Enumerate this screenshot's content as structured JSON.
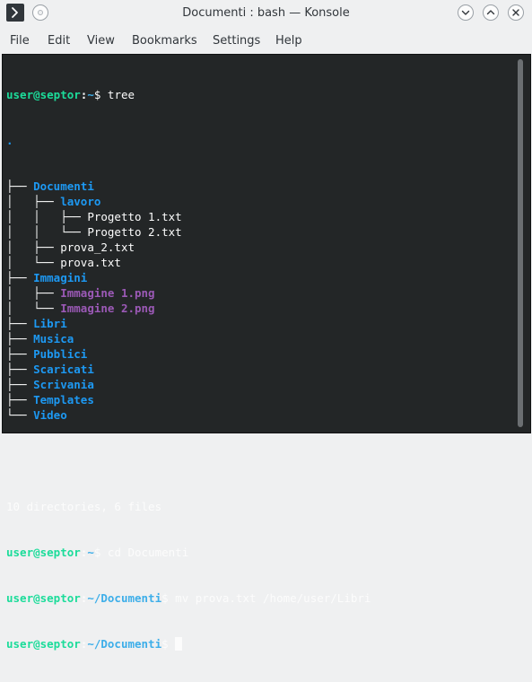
{
  "window": {
    "title": "Documenti : bash — Konsole",
    "app_icon": "konsole-icon",
    "controls": [
      "pin-icon",
      "minimize-icon",
      "maximize-icon",
      "close-icon"
    ]
  },
  "menubar": {
    "items": [
      "File",
      "Edit",
      "View",
      "Bookmarks",
      "Settings",
      "Help"
    ]
  },
  "terminal": {
    "prompt_user_host": "user@septor",
    "prompt_colon": ":",
    "prompt_dollar": "$",
    "cmd1_path": "~",
    "cmd1": " tree",
    "tree_root": ".",
    "tree": [
      {
        "prefix": "├── ",
        "name": "Documenti",
        "kind": "dir"
      },
      {
        "prefix": "│   ├── ",
        "name": "lavoro",
        "kind": "dir"
      },
      {
        "prefix": "│   │   ├── ",
        "name": "Progetto 1.txt",
        "kind": "file"
      },
      {
        "prefix": "│   │   └── ",
        "name": "Progetto 2.txt",
        "kind": "file"
      },
      {
        "prefix": "│   ├── ",
        "name": "prova_2.txt",
        "kind": "file"
      },
      {
        "prefix": "│   └── ",
        "name": "prova.txt",
        "kind": "file"
      },
      {
        "prefix": "├── ",
        "name": "Immagini",
        "kind": "dir"
      },
      {
        "prefix": "│   ├── ",
        "name": "Immagine 1.png",
        "kind": "image"
      },
      {
        "prefix": "│   └── ",
        "name": "Immagine 2.png",
        "kind": "image"
      },
      {
        "prefix": "├── ",
        "name": "Libri",
        "kind": "dir"
      },
      {
        "prefix": "├── ",
        "name": "Musica",
        "kind": "dir"
      },
      {
        "prefix": "├── ",
        "name": "Pubblici",
        "kind": "dir"
      },
      {
        "prefix": "├── ",
        "name": "Scaricati",
        "kind": "dir"
      },
      {
        "prefix": "├── ",
        "name": "Scrivania",
        "kind": "dir"
      },
      {
        "prefix": "├── ",
        "name": "Templates",
        "kind": "dir"
      },
      {
        "prefix": "└── ",
        "name": "Video",
        "kind": "dir"
      }
    ],
    "summary": "10 directories, 6 files",
    "cmd2_path": "~",
    "cmd2": " cd Documenti",
    "cmd3_path": "~/Documenti",
    "cmd3": " mv prova.txt /home/user/Libri",
    "cmd4_path": "~/Documenti",
    "cmd4": " "
  },
  "colors": {
    "user_host": "#1cdc9a",
    "path": "#3daee9",
    "directory": "#1d99f3",
    "image_file": "#9b59b6",
    "terminal_bg": "#232627",
    "terminal_fg": "#fcfcfc"
  }
}
